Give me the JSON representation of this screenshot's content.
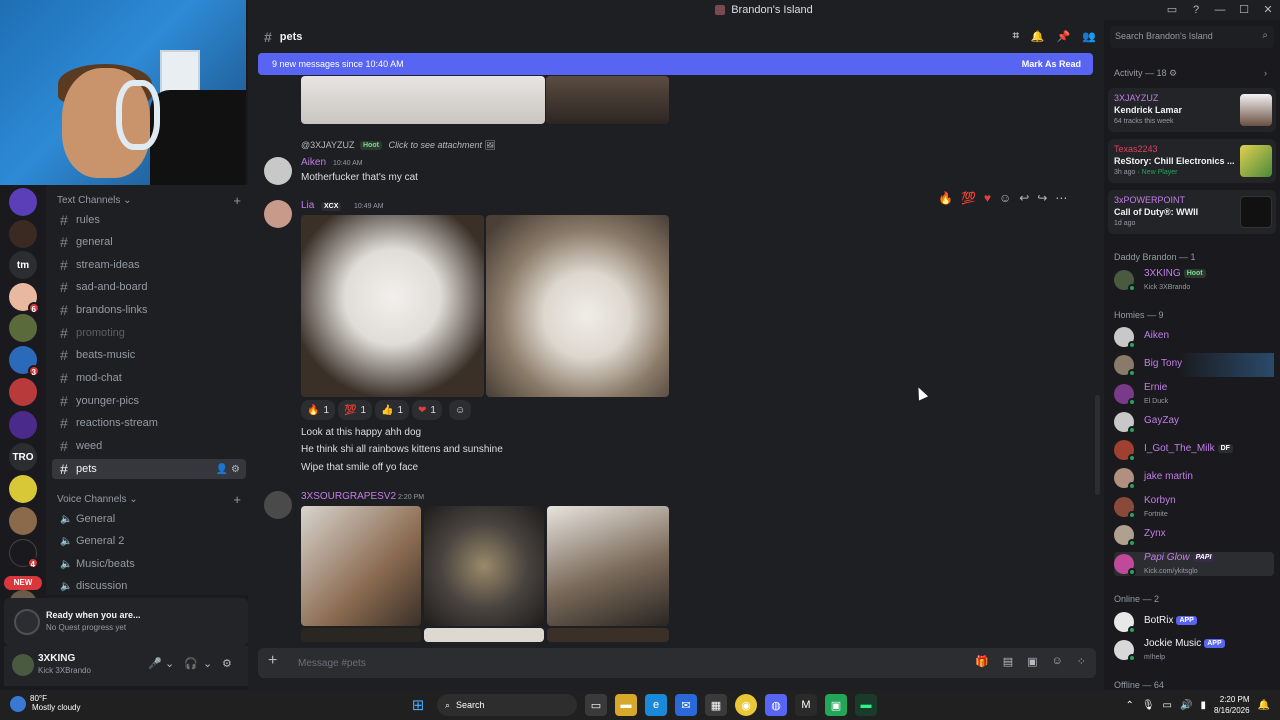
{
  "window": {
    "title": "Brandon's Island"
  },
  "rail": {
    "badges": [
      "6",
      "3",
      "4"
    ],
    "labels": [
      "tm",
      "TRO"
    ],
    "new_label": "NEW"
  },
  "sidebar": {
    "text_category": "Text Channels",
    "text_channels": [
      "rules",
      "general",
      "stream-ideas",
      "sad-and-board",
      "brandons-links",
      "promoting",
      "beats-music",
      "mod-chat",
      "younger-pics",
      "reactions-stream",
      "weed",
      "pets"
    ],
    "voice_category": "Voice Channels",
    "voice_channels": [
      "General",
      "General 2",
      "Music/beats",
      "discussion"
    ]
  },
  "quest": {
    "title": "Ready when you are...",
    "subtitle": "No Quest progress yet"
  },
  "user": {
    "name": "3XKING",
    "status": "Kick 3XBrando"
  },
  "header": {
    "channel": "pets",
    "search_placeholder": "Search Brandon's Island"
  },
  "new_messages": {
    "text": "9 new messages since 10:40 AM",
    "action": "Mark As Read"
  },
  "messages": {
    "reply": {
      "author": "@3XJAYZUZ",
      "tag": "Hoot",
      "text": "Click to see attachment"
    },
    "m1": {
      "author": "Aiken",
      "time": "10:40 AM",
      "text": "Motherfucker that's my cat"
    },
    "m2": {
      "author": "Lia",
      "tag": "XCX",
      "time": "10:49 AM",
      "reactions": [
        {
          "emoji": "🔥",
          "count": "1"
        },
        {
          "emoji": "💯",
          "count": "1"
        },
        {
          "emoji": "👍",
          "count": "1"
        },
        {
          "emoji": "❤",
          "count": "1"
        }
      ],
      "lines": [
        "Look at this happy ahh dog",
        "He think shi all rainbows kittens and sunshine",
        "Wipe that smile off yo face"
      ]
    },
    "m3": {
      "author": "3XSOURGRAPESV2",
      "time": "2:20 PM"
    }
  },
  "composer": {
    "placeholder": "Message #pets"
  },
  "members": {
    "activity_header": "Activity — 18",
    "activity": [
      {
        "user": "3XJAYZUZ",
        "title": "Kendrick Lamar",
        "meta": "64 tracks this week"
      },
      {
        "user": "Texas2243",
        "title": "ReStory: Chill Electronics ...",
        "meta": "3h ago",
        "meta2": "New Player"
      },
      {
        "user": "3xPOWERPOINT",
        "title": "Call of Duty®: WWII",
        "meta": "1d ago"
      }
    ],
    "daddy_header": "Daddy Brandon — 1",
    "daddy": {
      "name": "3XKING",
      "tag": "Hoot",
      "status": "Kick 3XBrando"
    },
    "homies_header": "Homies — 9",
    "homies": [
      {
        "name": "Aiken",
        "status": ""
      },
      {
        "name": "Big Tony",
        "status": ""
      },
      {
        "name": "Ernie",
        "status": "El Duck"
      },
      {
        "name": "GayZay",
        "status": ""
      },
      {
        "name": "I_Got_The_Milk",
        "tag": "DF",
        "status": ""
      },
      {
        "name": "jake martin",
        "status": ""
      },
      {
        "name": "Korbyn",
        "status": "Fortnite"
      },
      {
        "name": "Zynx",
        "status": ""
      },
      {
        "name": "Papi Glow",
        "tag": "PAPI",
        "status": "Kick.com/ykitsglo"
      }
    ],
    "online_header": "Online — 2",
    "online": [
      {
        "name": "BotRix",
        "tag": "APP",
        "status": ""
      },
      {
        "name": "Jockie Music",
        "tag": "APP",
        "status": "m!help"
      }
    ],
    "offline_header": "Offline — 64"
  },
  "taskbar": {
    "temp": "80°F",
    "weather": "Mostly cloudy",
    "search": "Search",
    "time": "2:20 PM",
    "date": "8/16/2026"
  },
  "colors": {
    "accent": "#5865f2",
    "role_purple": "#c27ee8",
    "online": "#23a55a"
  }
}
